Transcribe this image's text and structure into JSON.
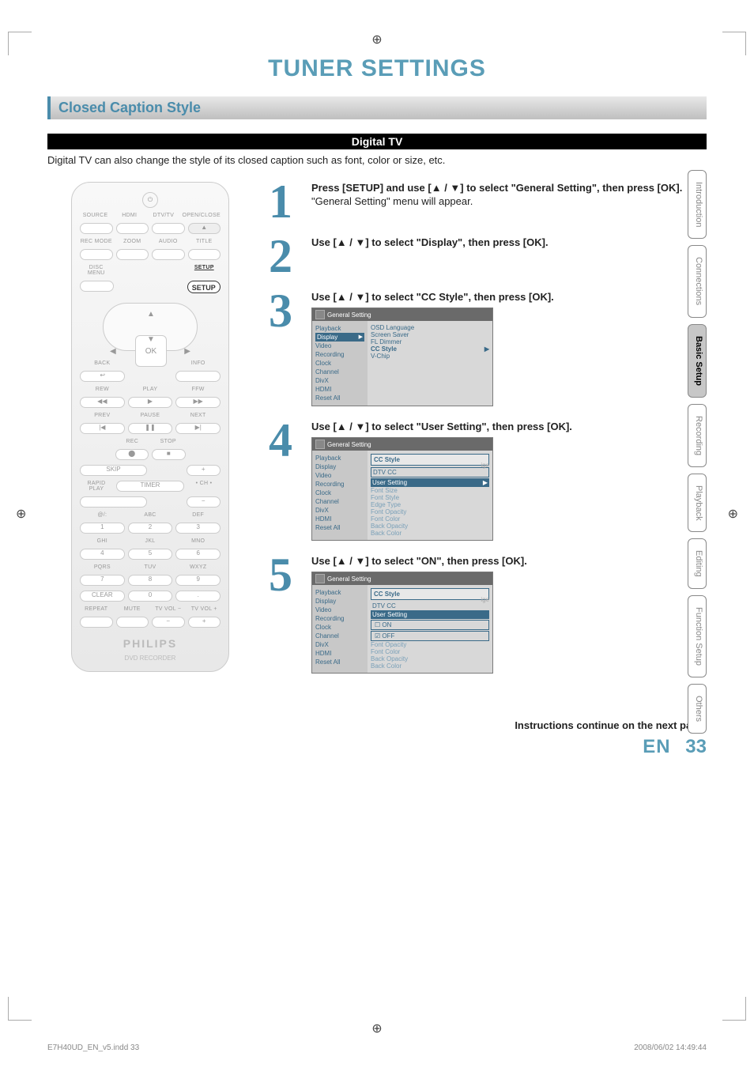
{
  "page_title": "TUNER SETTINGS",
  "section_title": "Closed Caption Style",
  "sub_bar": "Digital TV",
  "intro": "Digital TV can also change the style of its closed caption such as font, color or size, etc.",
  "remote": {
    "row1": [
      "SOURCE",
      "HDMI",
      "DTV/TV",
      "OPEN/CLOSE"
    ],
    "row2": [
      "REC MODE",
      "ZOOM",
      "AUDIO",
      "TITLE"
    ],
    "row3_left": "DISC MENU",
    "row3_right": "SETUP",
    "ok": "OK",
    "back": "BACK",
    "info": "INFO",
    "play": "PLAY",
    "rew": "REW",
    "ffw": "FFW",
    "prev": "PREV",
    "pause": "PAUSE",
    "next": "NEXT",
    "rec": "REC",
    "stop": "STOP",
    "skip": "SKIP",
    "timer": "TIMER",
    "chplus": "+",
    "chlabel": "• CH •",
    "chminus": "−",
    "rapid": "RAPID PLAY",
    "key_labels_r1": [
      "@/:",
      "ABC",
      "DEF"
    ],
    "key_labels_r2": [
      "GHI",
      "JKL",
      "MNO"
    ],
    "key_labels_r3": [
      "PQRS",
      "TUV",
      "WXYZ"
    ],
    "keys_r1": [
      "1",
      "2",
      "3"
    ],
    "keys_r2": [
      "4",
      "5",
      "6"
    ],
    "keys_r3": [
      "7",
      "8",
      "9"
    ],
    "keys_r4": [
      "CLEAR",
      "0",
      "."
    ],
    "bottom": [
      "REPEAT",
      "MUTE",
      "TV VOL −",
      "TV VOL +"
    ],
    "brand": "PHILIPS",
    "subbrand": "DVD RECORDER"
  },
  "steps": [
    {
      "num": "1",
      "instr": "Press [SETUP] and use [▲ / ▼] to select \"General Setting\", then press [OK].",
      "note": "\"General Setting\" menu will appear."
    },
    {
      "num": "2",
      "instr": "Use [▲ / ▼] to select \"Display\", then press [OK]."
    },
    {
      "num": "3",
      "instr": "Use [▲ / ▼] to select \"CC Style\", then press [OK].",
      "osd": {
        "title": "General Setting",
        "left": [
          "Playback",
          "Display",
          "Video",
          "Recording",
          "Clock",
          "Channel",
          "DivX",
          "HDMI",
          "Reset All"
        ],
        "left_sel": "Display",
        "right": [
          "OSD Language",
          "Screen Saver",
          "FL Dimmer",
          "CC Style",
          "V-Chip"
        ],
        "right_hl": "CC Style"
      }
    },
    {
      "num": "4",
      "instr": "Use [▲ / ▼] to select \"User Setting\", then press [OK].",
      "osd": {
        "title": "General Setting",
        "left": [
          "Playback",
          "Display",
          "Video",
          "Recording",
          "Clock",
          "Channel",
          "DivX",
          "HDMI",
          "Reset All"
        ],
        "right_box_title": "CC Style",
        "right_box_items": [
          "DTV CC",
          "User Setting"
        ],
        "right_box_hl": "User Setting",
        "right_dim": [
          "Font Size",
          "Font Style",
          "Edge Type",
          "Font Opacity",
          "Font Color",
          "Back Opacity",
          "Back Color"
        ],
        "bg_hint": "ige"
      }
    },
    {
      "num": "5",
      "instr": "Use [▲ / ▼] to select \"ON\", then press [OK].",
      "osd": {
        "title": "General Setting",
        "left": [
          "Playback",
          "Display",
          "Video",
          "Recording",
          "Clock",
          "Channel",
          "DivX",
          "HDMI",
          "Reset All"
        ],
        "right_box_title": "CC Style",
        "right_box_items": [
          "DTV CC",
          "User Setting"
        ],
        "right_box_hl": "User Setting",
        "options": [
          "ON",
          "OFF"
        ],
        "option_checked": "OFF",
        "right_dim": [
          "Font Opacity",
          "Font Color",
          "Back Opacity",
          "Back Color"
        ],
        "bg_hint": "ige"
      }
    }
  ],
  "tabs": [
    "Introduction",
    "Connections",
    "Basic Setup",
    "Recording",
    "Playback",
    "Editing",
    "Function Setup",
    "Others"
  ],
  "tab_active": "Basic Setup",
  "continue_note": "Instructions continue on the next page.",
  "page_lang": "EN",
  "page_num": "33",
  "footer_left": "E7H40UD_EN_v5.indd   33",
  "footer_right": "2008/06/02   14:49:44"
}
